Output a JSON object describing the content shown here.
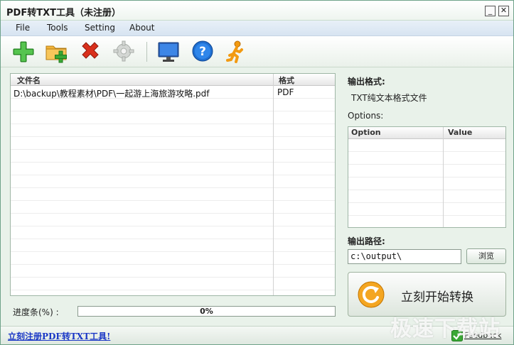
{
  "window": {
    "title": "PDF转TXT工具（未注册）",
    "min_label": "_",
    "close_label": "✕"
  },
  "menu": [
    "File",
    "Tools",
    "Setting",
    "About"
  ],
  "toolbar": {
    "icons": [
      "add-file-icon",
      "add-folder-icon",
      "remove-icon",
      "settings-icon",
      "monitor-icon",
      "help-icon",
      "run-icon"
    ],
    "colors": {
      "green": "#3aa835",
      "red": "#d9301c",
      "blue": "#1f6fd1"
    }
  },
  "file_list": {
    "columns": [
      "文件名",
      "格式"
    ],
    "rows": [
      {
        "name": "D:\\backup\\教程素材\\PDF\\一起游上海旅游攻略.pdf",
        "format": "PDF"
      }
    ]
  },
  "progress": {
    "label": "进度条(%)  :",
    "value": 0,
    "text": "0%"
  },
  "output_format": {
    "label": "输出格式:",
    "value": "TXT纯文本格式文件"
  },
  "options": {
    "label": "Options:",
    "columns": [
      "Option",
      "Value"
    ]
  },
  "output_path": {
    "label": "输出路径:",
    "value": "c:\\output\\",
    "browse_label": "浏览"
  },
  "start_button": {
    "label": "立刻开始转换"
  },
  "status": {
    "register_link": "立刻注册PDF转TXT工具!",
    "feedback_label": "Feedback"
  },
  "watermark": "极速下载站"
}
